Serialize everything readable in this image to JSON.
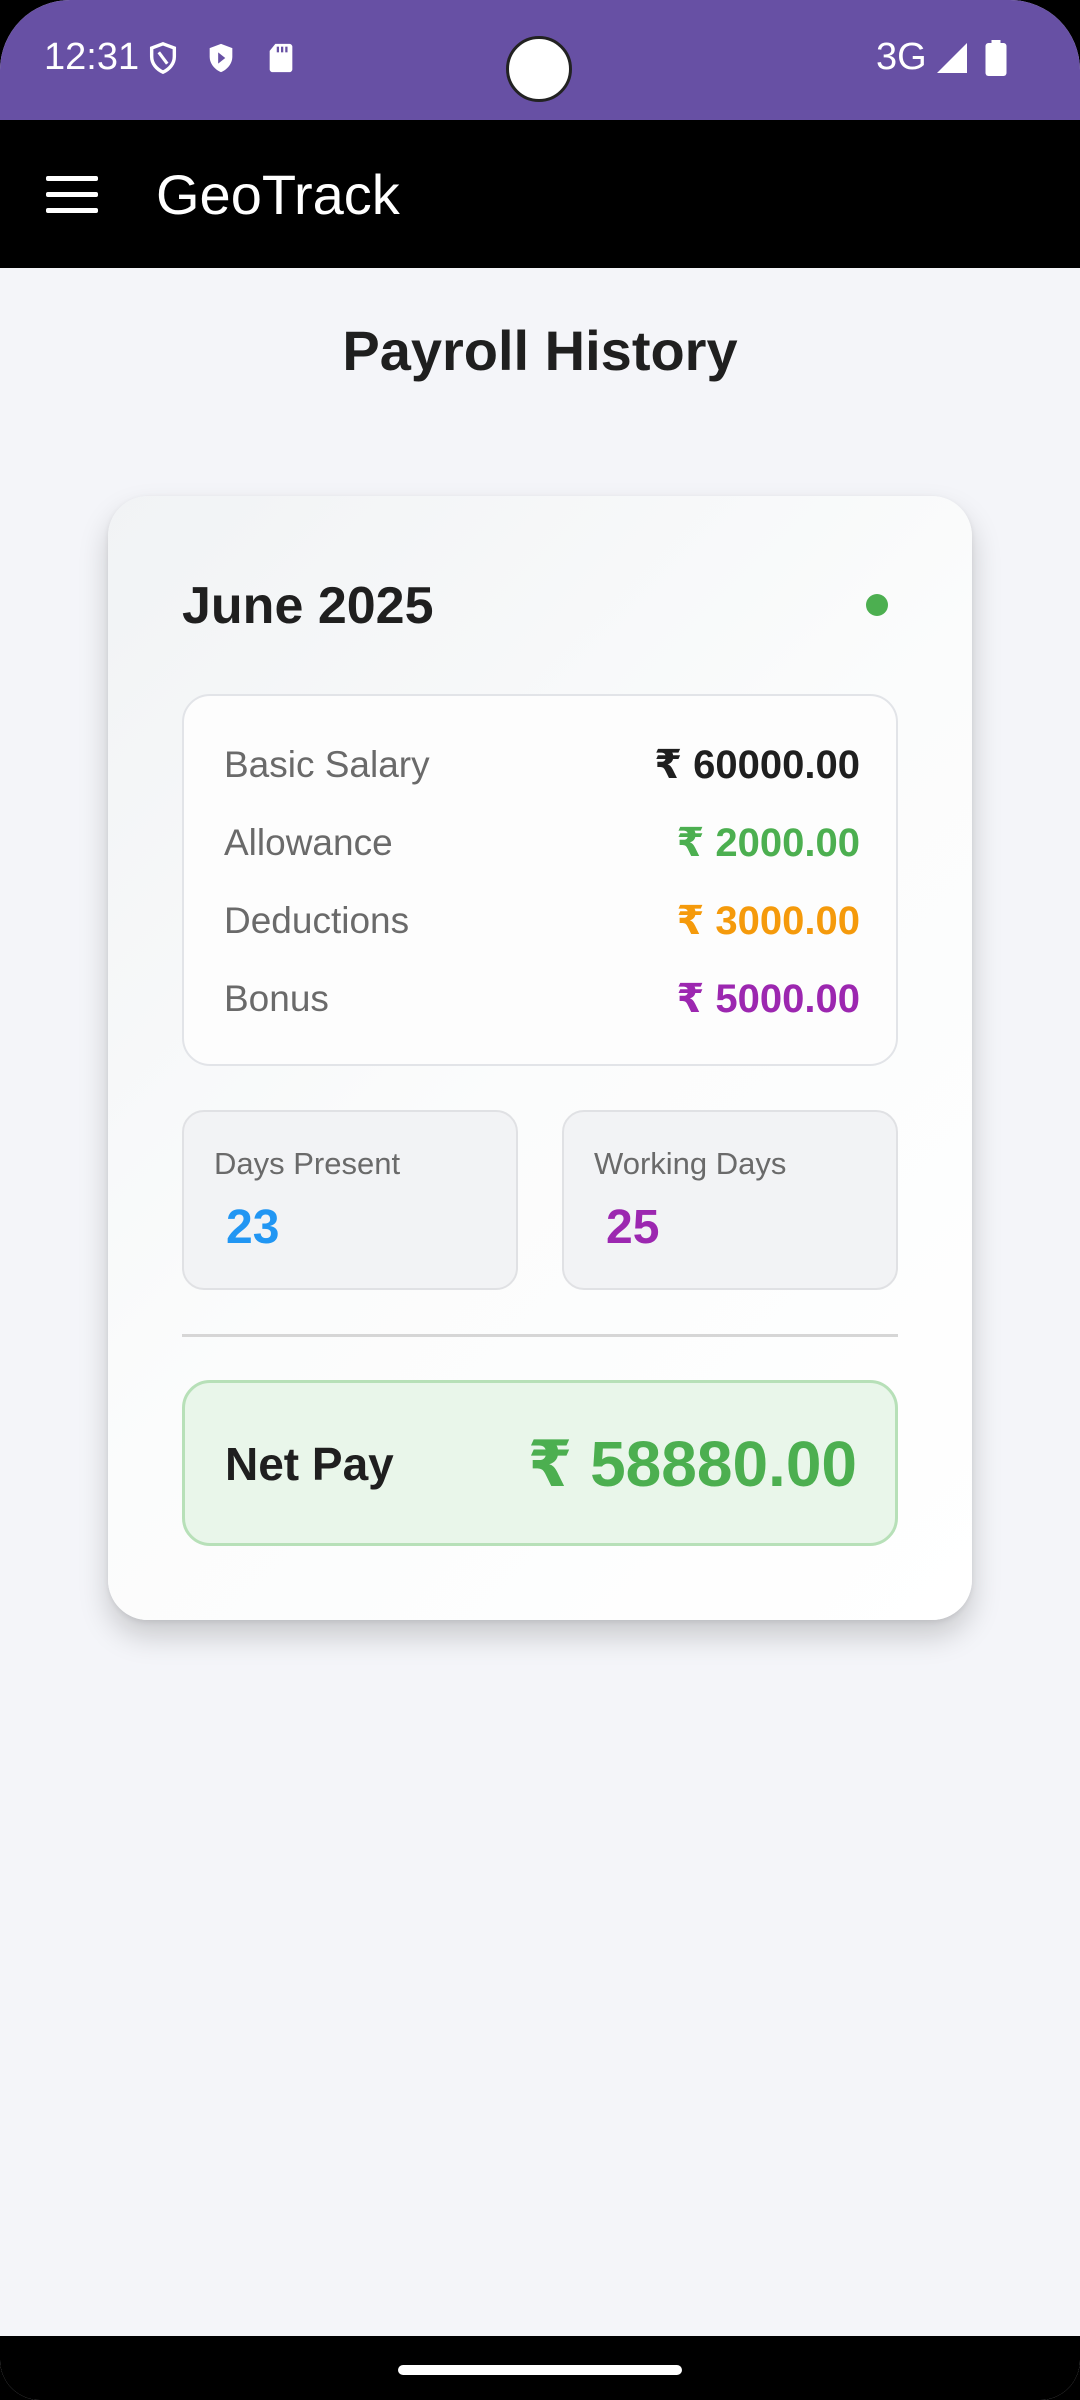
{
  "status_bar": {
    "time": "12:31",
    "network": "3G",
    "icons": [
      "shield-outline-icon",
      "shield-play-icon",
      "sd-card-icon",
      "signal-icon",
      "battery-icon"
    ]
  },
  "app_bar": {
    "title": "GeoTrack",
    "menu_icon": "hamburger-menu-icon"
  },
  "page": {
    "title": "Payroll History"
  },
  "payroll_card": {
    "month": "June 2025",
    "status_dot_color": "#4caf50",
    "breakdown": [
      {
        "label": "Basic Salary",
        "value": "₹ 60000.00",
        "color": "#1f1f1f"
      },
      {
        "label": "Allowance",
        "value": "₹ 2000.00",
        "color": "#4caf50"
      },
      {
        "label": "Deductions",
        "value": "₹ 3000.00",
        "color": "#f59a0b"
      },
      {
        "label": "Bonus",
        "value": "₹ 5000.00",
        "color": "#9c27b0"
      }
    ],
    "days_present": {
      "label": "Days Present",
      "value": "23",
      "color": "#2196f3"
    },
    "working_days": {
      "label": "Working Days",
      "value": "25",
      "color": "#9c27b0"
    },
    "net_pay": {
      "label": "Net Pay",
      "value": "₹ 58880.00",
      "color": "#4caf50"
    }
  },
  "colors": {
    "status_bar": "#6750a4",
    "app_bar": "#000000",
    "background": "#f4f5f9"
  }
}
